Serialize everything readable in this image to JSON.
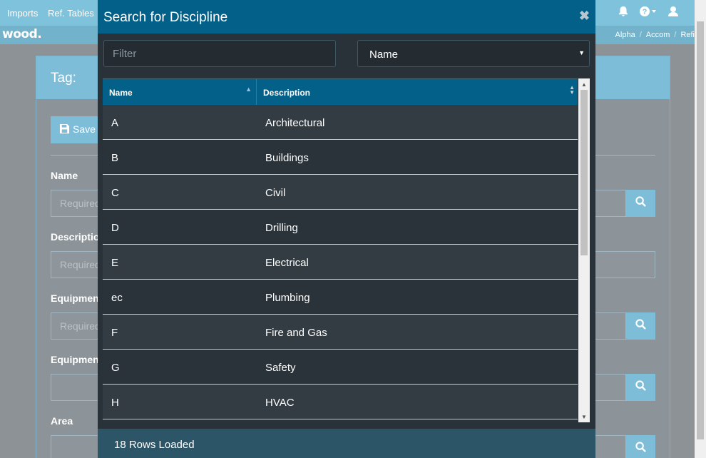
{
  "topbar": {
    "nav": [
      "Imports",
      "Ref. Tables"
    ],
    "icons": [
      "bell-icon",
      "help-icon",
      "user-icon"
    ]
  },
  "brand": {
    "logo": "wood."
  },
  "breadcrumbs": [
    "Alpha",
    "Accom",
    "Refi"
  ],
  "panel": {
    "title": "Tag:",
    "save_label": "Save",
    "fields": [
      {
        "label": "Name",
        "placeholder": "Required"
      },
      {
        "label": "Description",
        "placeholder": "Required"
      },
      {
        "label": "Equipment",
        "placeholder": "Required"
      },
      {
        "label": "Equipment",
        "placeholder": ""
      },
      {
        "label": "Area",
        "placeholder": ""
      }
    ]
  },
  "modal": {
    "title": "Search for Discipline",
    "close_glyph": "✖",
    "filter_placeholder": "Filter",
    "filter_value": "",
    "sort_field": "Name",
    "columns": {
      "name": "Name",
      "description": "Description"
    },
    "rows": [
      {
        "name": "A",
        "description": "Architectural"
      },
      {
        "name": "B",
        "description": "Buildings"
      },
      {
        "name": "C",
        "description": "Civil"
      },
      {
        "name": "D",
        "description": "Drilling"
      },
      {
        "name": "E",
        "description": "Electrical"
      },
      {
        "name": "ec",
        "description": "Plumbing"
      },
      {
        "name": "F",
        "description": "Fire and Gas"
      },
      {
        "name": "G",
        "description": "Safety"
      },
      {
        "name": "H",
        "description": "HVAC"
      }
    ],
    "footer": "18 Rows Loaded"
  },
  "colors": {
    "modal_header": "#036088",
    "modal_body": "#2a3239",
    "accent_light": "#7ebdd8"
  }
}
